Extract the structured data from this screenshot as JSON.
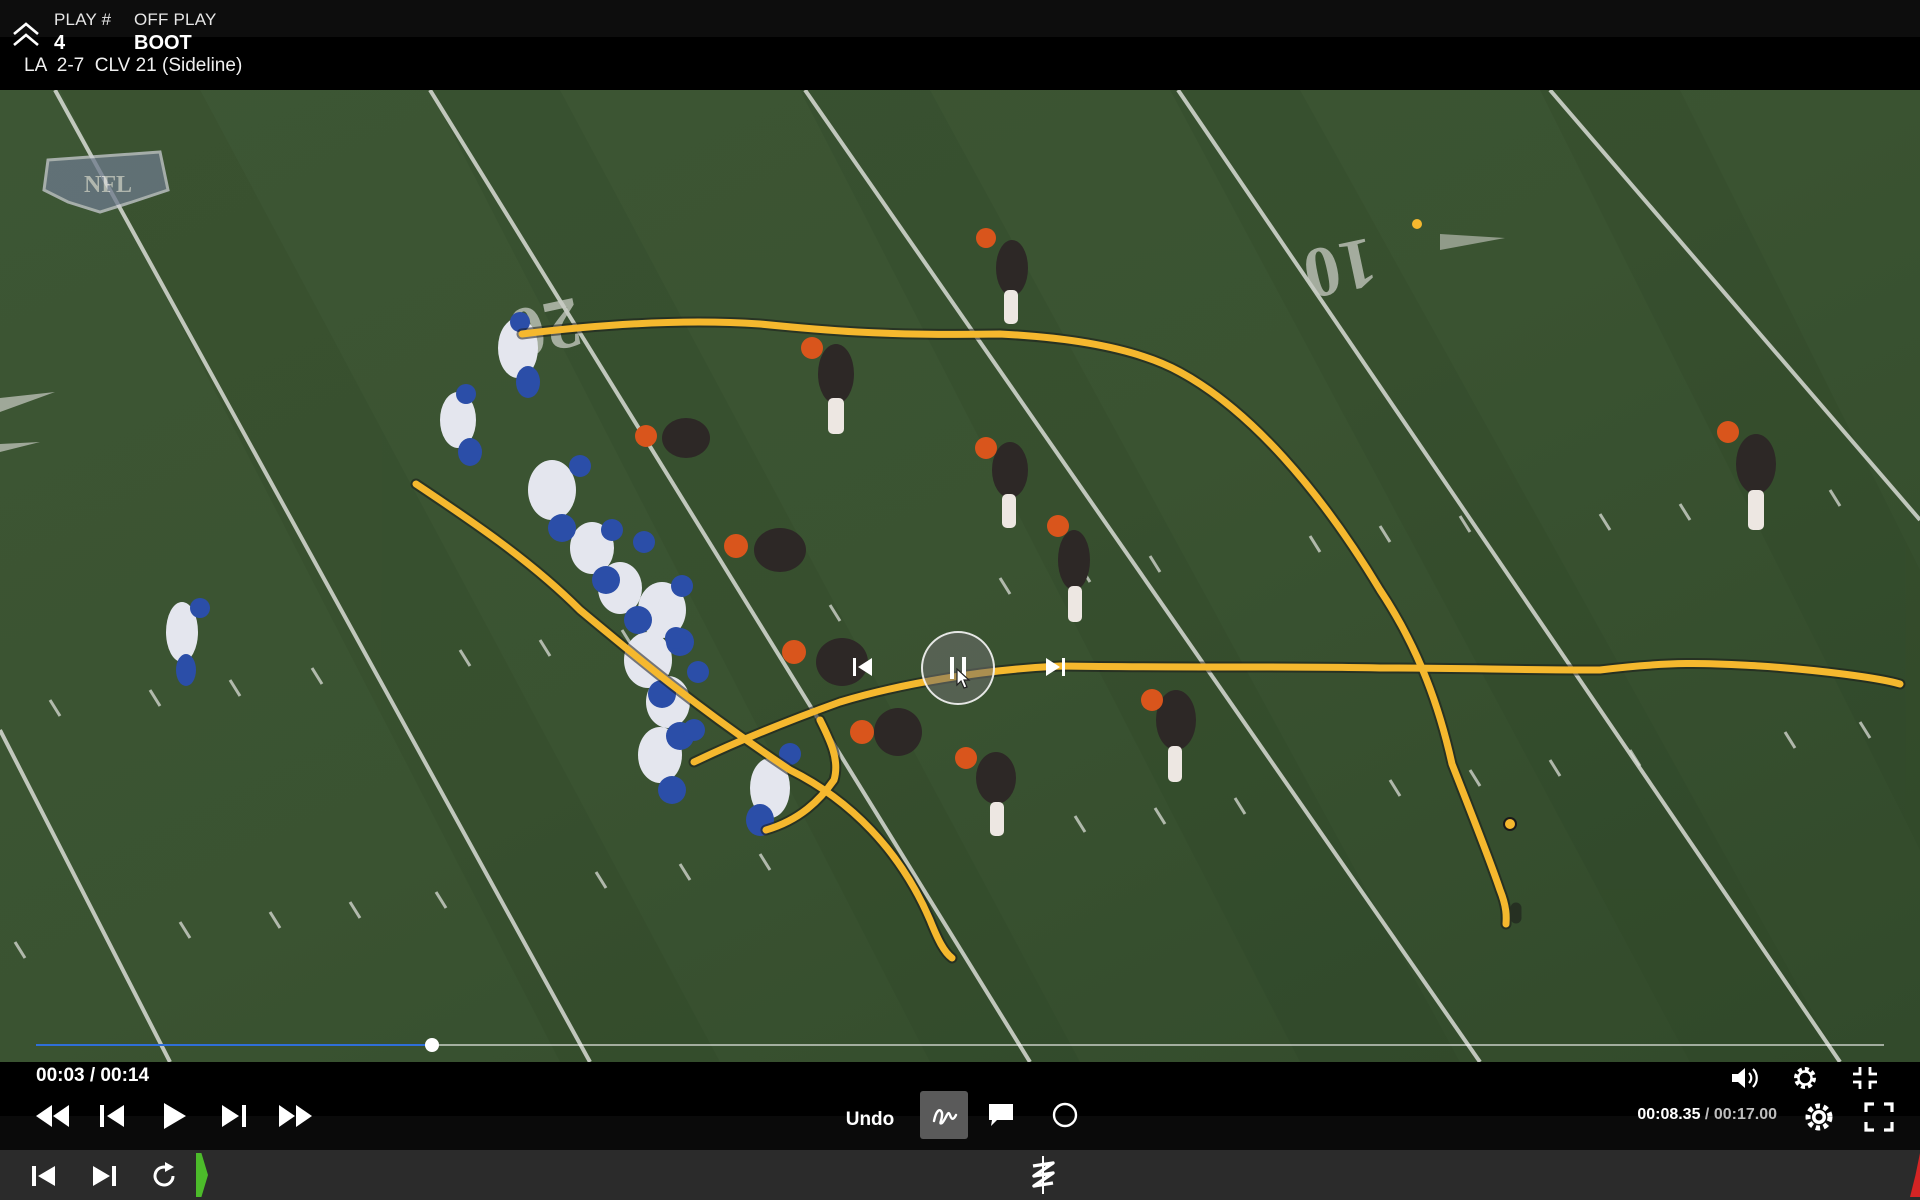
{
  "header": {
    "play_number_label": "PLAY #",
    "play_number": "4",
    "off_play_label": "OFF PLAY",
    "off_play": "BOOT",
    "game_line": "LA  2-7  CLV 21 (Sideline)"
  },
  "video": {
    "field_logo": "NFL",
    "yard_numbers": [
      "20",
      "10"
    ],
    "overlay": {
      "prev_icon": "skip-back-icon",
      "pause_icon": "pause-icon",
      "next_icon": "skip-forward-icon"
    },
    "progress_fraction": 0.2143,
    "progress_color": "#2f6fd8",
    "telestration_color": "#f5b82e"
  },
  "controls": {
    "time": "00:03 / 00:14",
    "undo_label": "Undo",
    "clip_time_current": "00:08.35",
    "clip_time_separator": " / ",
    "clip_time_total": "00:17.00",
    "icons": {
      "rewind": "rewind-icon",
      "step_back": "step-back-icon",
      "play": "play-icon",
      "step_forward": "step-forward-icon",
      "fast_forward": "fast-forward-icon",
      "draw": "freehand-draw-icon",
      "comment": "comment-icon",
      "circle": "circle-icon",
      "volume": "volume-icon",
      "settings": "gear-icon",
      "exit_fullscreen": "exit-fullscreen-icon",
      "fullscreen": "fullscreen-icon"
    }
  },
  "bottom_bar": {
    "icons": [
      "previous-play-icon",
      "next-play-icon",
      "replay-icon",
      "app-logo-icon"
    ],
    "accent_green": "#4cbb2a",
    "accent_red": "#d42424"
  }
}
